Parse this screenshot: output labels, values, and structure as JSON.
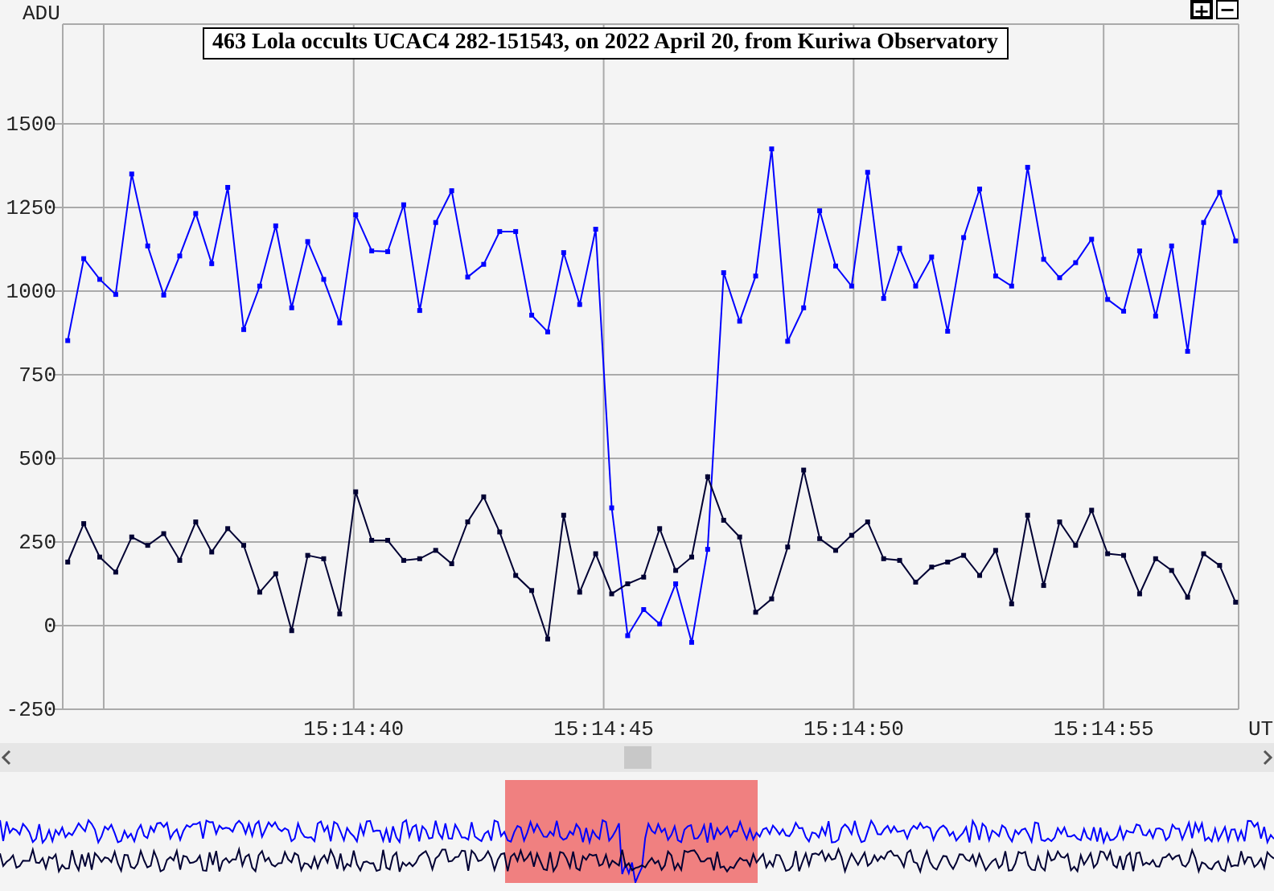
{
  "zoom_buttons": [
    "+",
    "−"
  ],
  "chart": {
    "chart_data": {
      "type": "line",
      "title": "463 Lola occults UCAC4 282-151543, on 2022 April 20, from Kuriwa Observatory",
      "xlabel": "UT",
      "ylabel": "ADU",
      "x": [
        54874.28,
        54874.6,
        54874.92,
        54875.24,
        54875.56,
        54875.88,
        54876.2,
        54876.52,
        54876.84,
        54877.16,
        54877.48,
        54877.8,
        54878.12,
        54878.44,
        54878.76,
        54879.08,
        54879.4,
        54879.72,
        54880.04,
        54880.36,
        54880.68,
        54881.0,
        54881.32,
        54881.64,
        54881.96,
        54882.28,
        54882.6,
        54882.92,
        54883.24,
        54883.56,
        54883.88,
        54884.2,
        54884.52,
        54884.84,
        54885.16,
        54885.48,
        54885.8,
        54886.12,
        54886.44,
        54886.76,
        54887.08,
        54887.4,
        54887.72,
        54888.04,
        54888.36,
        54888.68,
        54889.0,
        54889.32,
        54889.64,
        54889.96,
        54890.28,
        54890.6,
        54890.92,
        54891.24,
        54891.56,
        54891.88,
        54892.2,
        54892.52,
        54892.84,
        54893.16,
        54893.48,
        54893.8,
        54894.12,
        54894.44,
        54894.76,
        54895.08,
        54895.4,
        54895.72,
        54896.04,
        54896.36,
        54896.68,
        54897.0,
        54897.32,
        54897.64
      ],
      "series": [
        {
          "color": "#0000ff",
          "marker": "square",
          "values": [
            852,
            1097,
            1035,
            990,
            1350,
            1135,
            988,
            1105,
            1232,
            1082,
            1310,
            885,
            1015,
            1195,
            950,
            1148,
            1035,
            905,
            1228,
            1120,
            1118,
            1258,
            942,
            1205,
            1300,
            1042,
            1080,
            1178,
            1178,
            928,
            878,
            1115,
            960,
            1185,
            352,
            -30,
            48,
            5,
            125,
            -50,
            228,
            1055,
            910,
            1045,
            1425,
            850,
            950,
            1240,
            1075,
            1015,
            1355,
            978,
            1128,
            1015,
            1102,
            880,
            1160,
            1305,
            1045,
            1015,
            1370,
            1095,
            1040,
            1085,
            1155,
            975,
            940,
            1120,
            925,
            1135,
            820,
            1205,
            1295,
            1150
          ]
        },
        {
          "color": "#000033",
          "marker": "square",
          "values": [
            190,
            305,
            205,
            160,
            265,
            240,
            275,
            195,
            310,
            220,
            290,
            240,
            100,
            155,
            -15,
            210,
            200,
            35,
            400,
            255,
            255,
            195,
            200,
            225,
            185,
            310,
            385,
            280,
            150,
            105,
            -40,
            330,
            100,
            215,
            95,
            125,
            145,
            290,
            165,
            205,
            445,
            315,
            265,
            40,
            80,
            235,
            465,
            260,
            225,
            270,
            310,
            200,
            195,
            130,
            175,
            190,
            210,
            150,
            225,
            65,
            330,
            120,
            310,
            240,
            345,
            215,
            210,
            95,
            200,
            165,
            85,
            215,
            180,
            70
          ]
        }
      ],
      "grid": true,
      "xlim": [
        54874.18,
        54897.7
      ],
      "ylim": [
        -250,
        1798
      ],
      "xticks": [
        {
          "value": 54880,
          "label": "15:14:40"
        },
        {
          "value": 54885,
          "label": "15:14:45"
        },
        {
          "value": 54890,
          "label": "15:14:50"
        },
        {
          "value": 54895,
          "label": "15:14:55"
        }
      ],
      "yticks": [
        -250,
        0,
        250,
        500,
        750,
        1000,
        1250,
        1500
      ]
    }
  },
  "scrollbar": {
    "level": 0.5
  }
}
